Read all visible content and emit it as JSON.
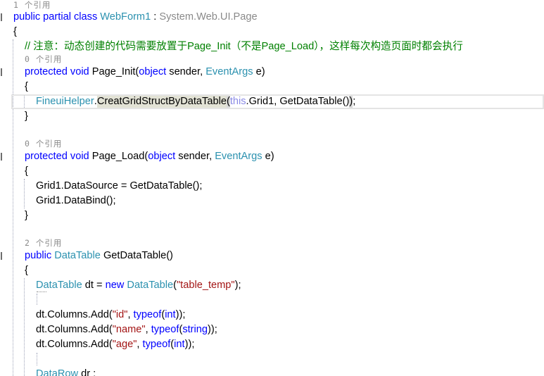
{
  "theme": {
    "background": "#ffffff",
    "text": "#000000",
    "keyword": "#0000ff",
    "type": "#2b91af",
    "string": "#a31515",
    "comment": "#008000",
    "faded": "#8a8a8a",
    "faded_keyword": "#8a8ae6",
    "codelens": "#8a8a8a",
    "reference_highlight": "#e2e2d5",
    "brace_highlight": "#d9d9d9",
    "current_line_border": "#e4e4e4",
    "indent_guide": "#9ea3b8",
    "margin_marker": "#6e6e6e"
  },
  "codelens": [
    "1 个引用",
    "0 个引用",
    "0 个引用",
    "2 个引用"
  ],
  "lines": [
    [
      "public partial class ",
      "WebForm1",
      " : ",
      "System.Web.UI.Page"
    ],
    [
      "{"
    ],
    [
      "// 注意：动态创建的代码需要放置于Page_Init（不是Page_Load），这样每次构造页面时都会执行"
    ],
    [
      "protected void ",
      "Page_Init(",
      "object",
      " sender, ",
      "EventArgs",
      " e)"
    ],
    [
      "{"
    ],
    [
      "FineuiHelper",
      ".",
      "CreatGridStructByDataTable",
      "(",
      "this",
      ".Grid1, GetDataTable()",
      ")",
      ";"
    ],
    [
      "}"
    ],
    [],
    [
      "protected void ",
      "Page_Load(",
      "object",
      " sender, ",
      "EventArgs",
      " e)"
    ],
    [
      "{"
    ],
    [
      "Grid1.DataSource = GetDataTable();"
    ],
    [
      "Grid1.DataBind();"
    ],
    [
      "}"
    ],
    [],
    [
      "public ",
      "DataTable",
      " GetDataTable()"
    ],
    [
      "{"
    ],
    [
      "DataTable",
      " dt = ",
      "new ",
      "DataTable",
      "(",
      "\"table_temp\"",
      ");"
    ],
    [],
    [
      "dt.Columns.Add(",
      "\"id\"",
      ", ",
      "typeof",
      "(",
      "int",
      "));"
    ],
    [
      "dt.Columns.Add(",
      "\"name\"",
      ", ",
      "typeof",
      "(",
      "string",
      "));"
    ],
    [
      "dt.Columns.Add(",
      "\"age\"",
      ", ",
      "typeof",
      "(",
      "int",
      "));"
    ],
    [],
    [
      "DataRow",
      " dr ;"
    ]
  ]
}
